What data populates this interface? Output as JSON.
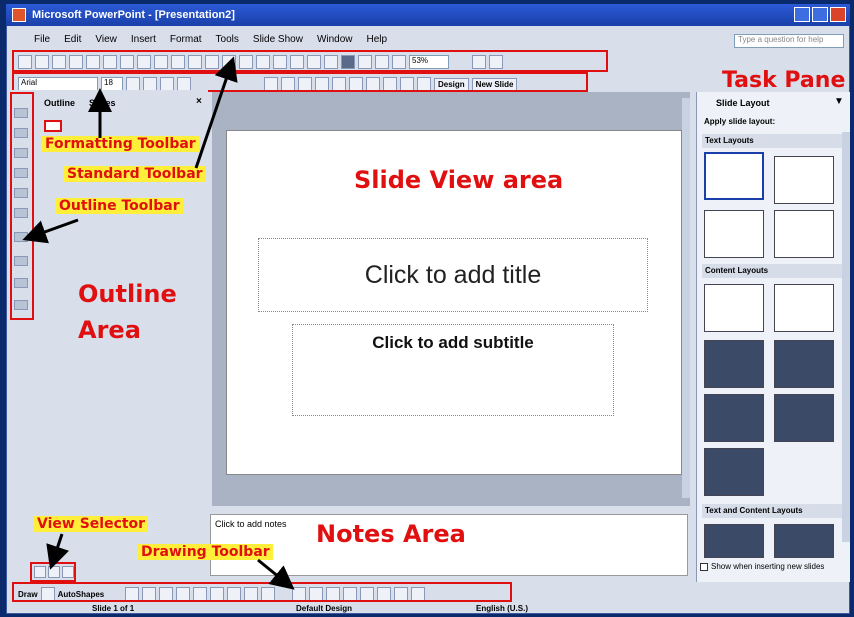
{
  "window": {
    "title": "Microsoft PowerPoint - [Presentation2]",
    "help_placeholder": "Type a question for help"
  },
  "menu": [
    "File",
    "Edit",
    "View",
    "Insert",
    "Format",
    "Tools",
    "Slide Show",
    "Window",
    "Help"
  ],
  "standard_toolbar": {
    "zoom": "53%"
  },
  "formatting_toolbar": {
    "font": "Arial",
    "size": "18",
    "design_label": "Design",
    "new_slide_label": "New Slide"
  },
  "outline": {
    "tab_outline": "Outline",
    "tab_slides": "Slides",
    "close": "×"
  },
  "slide": {
    "title_placeholder": "Click to add title",
    "subtitle_placeholder": "Click to add subtitle"
  },
  "notes": {
    "placeholder": "Click to add notes"
  },
  "task_pane": {
    "header": "Slide Layout",
    "apply_label": "Apply slide layout:",
    "sections": [
      "Text Layouts",
      "Content Layouts",
      "Text and Content Layouts"
    ],
    "show_checkbox": "Show when inserting new slides"
  },
  "drawing_toolbar": {
    "draw": "Draw",
    "autoshapes": "AutoShapes"
  },
  "status": {
    "slide": "Slide 1 of 1",
    "design": "Default Design",
    "language": "English (U.S.)"
  },
  "annotations": {
    "formatting_toolbar": "Formatting Toolbar",
    "standard_toolbar": "Standard Toolbar",
    "outline_toolbar": "Outline Toolbar",
    "outline_area_1": "Outline",
    "outline_area_2": "Area",
    "slide_view_area": "Slide View area",
    "task_pane": "Task Pane",
    "view_selector": "View Selector",
    "drawing_toolbar": "Drawing Toolbar",
    "notes_area": "Notes Area"
  },
  "colors": {
    "annotation": "#e01010",
    "highlight": "#ffef3a",
    "titlebar": "#1a3fa8"
  }
}
